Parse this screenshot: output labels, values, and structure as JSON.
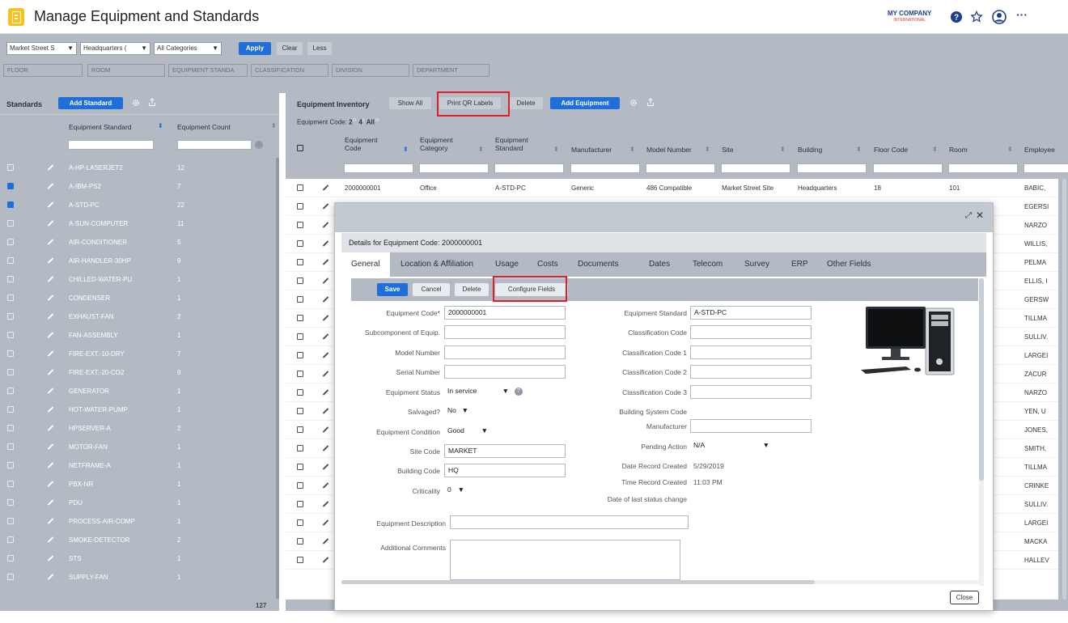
{
  "app": {
    "title": "Manage Equipment and Standards",
    "brand": "MY COMPANY",
    "brand_sub": "INTERNATIONAL"
  },
  "filters": {
    "site": "Market Street S",
    "building": "Headquarters (",
    "category": "All Categories",
    "apply": "Apply",
    "clear": "Clear",
    "less": "Less",
    "placeholders": [
      "FLOOR",
      "ROOM",
      "EQUIPMENT STANDA",
      "CLASSIFICATION",
      "DIVISION",
      "DEPARTMENT"
    ]
  },
  "standards": {
    "title": "Standards",
    "add": "Add Standard",
    "col_std": "Equipment Standard",
    "col_count": "Equipment Count",
    "rows": [
      {
        "name": "A-HP-LASERJET2",
        "count": "12",
        "checked": false
      },
      {
        "name": "A-IBM-PS2",
        "count": "7",
        "checked": true
      },
      {
        "name": "A-STD-PC",
        "count": "22",
        "checked": true
      },
      {
        "name": "A-SUN-COMPUTER",
        "count": "11",
        "checked": false
      },
      {
        "name": "AIR-CONDITIONER",
        "count": "5",
        "checked": false
      },
      {
        "name": "AIR-HANDLER-30HP",
        "count": "9",
        "checked": false
      },
      {
        "name": "CHILLED-WATER-PU",
        "count": "1",
        "checked": false
      },
      {
        "name": "CONDENSER",
        "count": "1",
        "checked": false
      },
      {
        "name": "EXHAUST-FAN",
        "count": "2",
        "checked": false
      },
      {
        "name": "FAN-ASSEMBLY",
        "count": "1",
        "checked": false
      },
      {
        "name": "FIRE-EXT.-10-DRY",
        "count": "7",
        "checked": false
      },
      {
        "name": "FIRE-EXT.-20-CO2",
        "count": "9",
        "checked": false
      },
      {
        "name": "GENERATOR",
        "count": "1",
        "checked": false
      },
      {
        "name": "HOT-WATER-PUMP",
        "count": "1",
        "checked": false
      },
      {
        "name": "HPSERVER-A",
        "count": "2",
        "checked": false
      },
      {
        "name": "MOTOR-FAN",
        "count": "1",
        "checked": false
      },
      {
        "name": "NETFRAME-A",
        "count": "1",
        "checked": false
      },
      {
        "name": "PBX-NR",
        "count": "1",
        "checked": false
      },
      {
        "name": "PDU",
        "count": "1",
        "checked": false
      },
      {
        "name": "PROCESS-AIR-COMP",
        "count": "1",
        "checked": false
      },
      {
        "name": "SMOKE-DETECTOR",
        "count": "2",
        "checked": false
      },
      {
        "name": "STS",
        "count": "1",
        "checked": false
      },
      {
        "name": "SUPPLY-FAN",
        "count": "1",
        "checked": false
      }
    ],
    "total": "127"
  },
  "inventory": {
    "title": "Equipment Inventory",
    "show_all": "Show All",
    "print_qr": "Print QR Labels",
    "delete": "Delete",
    "add": "Add Equipment",
    "code_label": "Equipment Code:",
    "codes": [
      {
        "v": "2",
        "n": "21"
      },
      {
        "v": "4",
        "n": "8"
      },
      {
        "v": "All",
        "n": "29"
      }
    ],
    "cols": [
      "Equipment\nCode",
      "Equipment\nCategory",
      "Equipment\nStandard",
      "Manufacturer",
      "Model Number",
      "Site",
      "Building",
      "Floor Code",
      "Room",
      "Employee"
    ],
    "first_row": [
      "2000000001",
      "Office",
      "A-STD-PC",
      "Generic",
      "486 Compatible",
      "Market Street Site",
      "Headquarters",
      "18",
      "101",
      "BABIC,"
    ],
    "employees": [
      "EGERSI",
      "NARZO",
      "WILLIS,",
      "PELMA",
      "ELLIS, I",
      "GERSW",
      "TILLMA",
      "SULLIV.",
      "LARGEI",
      "ZACUR",
      "NARZO",
      "YEN, U",
      "JONES,",
      "SMITH,",
      "TILLMA",
      "CRINKE",
      "SULLIV.",
      "LARGEI",
      "MACKA",
      "HALLEV"
    ]
  },
  "dialog": {
    "title": "Details for Equipment Code: 2000000001",
    "tabs": [
      "General",
      "Location & Affiliation",
      "Usage",
      "Costs",
      "Documents",
      "Dates",
      "Telecom",
      "Survey",
      "ERP",
      "Other Fields"
    ],
    "save": "Save",
    "cancel": "Cancel",
    "delete": "Delete",
    "configure": "Configure Fields",
    "close": "Close",
    "left": {
      "equipment_code": {
        "label": "Equipment Code*",
        "value": "2000000001"
      },
      "subcomponent": {
        "label": "Subcomponent of Equip.",
        "value": ""
      },
      "model_number": {
        "label": "Model Number",
        "value": ""
      },
      "serial_number": {
        "label": "Serial Number",
        "value": ""
      },
      "status": {
        "label": "Equipment Status",
        "value": "In service"
      },
      "salvaged": {
        "label": "Salvaged?",
        "value": "No"
      },
      "condition": {
        "label": "Equipment Condition",
        "value": "Good"
      },
      "site_code": {
        "label": "Site Code",
        "value": "MARKET"
      },
      "building_code": {
        "label": "Building Code",
        "value": "HQ"
      },
      "criticality": {
        "label": "Criticality",
        "value": "0"
      },
      "description": {
        "label": "Equipment Description",
        "value": ""
      },
      "comments": {
        "label": "Additional Comments",
        "value": ""
      }
    },
    "right": {
      "standard": {
        "label": "Equipment Standard",
        "value": "A-STD-PC"
      },
      "class": {
        "label": "Classification Code",
        "value": ""
      },
      "class1": {
        "label": "Classification Code 1",
        "value": ""
      },
      "class2": {
        "label": "Classification Code 2",
        "value": ""
      },
      "class3": {
        "label": "Classification Code 3",
        "value": ""
      },
      "bsc": {
        "label": "Building System Code"
      },
      "manufacturer": {
        "label": "Manufacturer",
        "value": ""
      },
      "pending": {
        "label": "Pending Action",
        "value": "N/A"
      },
      "created_date": {
        "label": "Date Record Created",
        "value": "5/29/2019"
      },
      "created_time": {
        "label": "Time Record Created",
        "value": "11:03 PM"
      },
      "last_status": {
        "label": "Date of last status change"
      }
    }
  }
}
